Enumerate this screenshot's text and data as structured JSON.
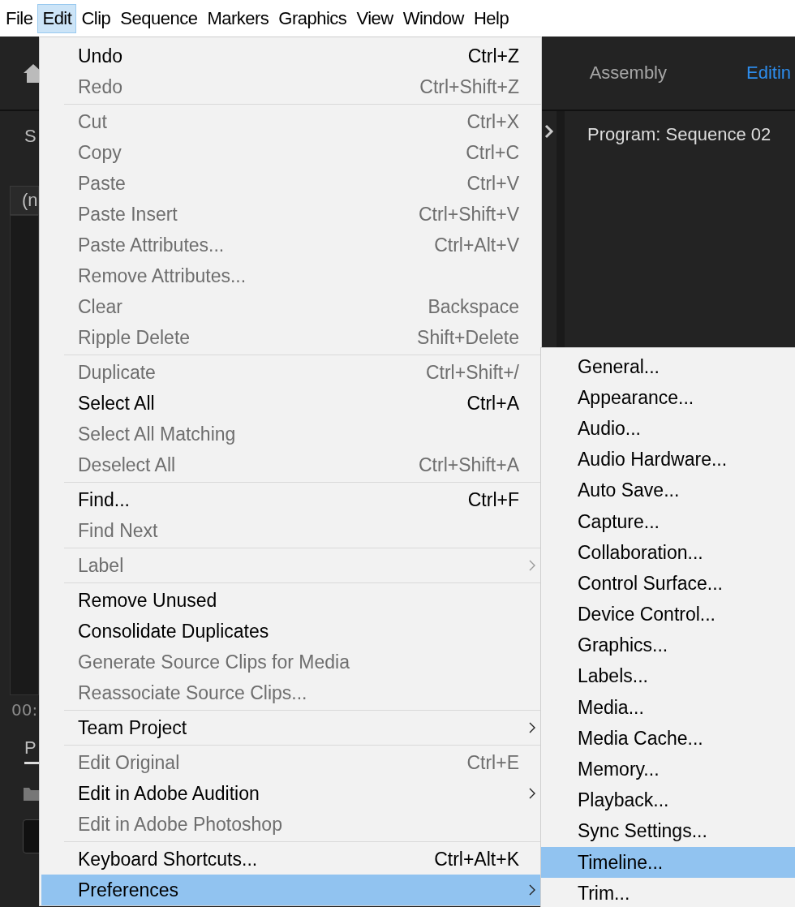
{
  "menubar": [
    {
      "label": "File",
      "selected": false
    },
    {
      "label": "Edit",
      "selected": true
    },
    {
      "label": "Clip",
      "selected": false
    },
    {
      "label": "Sequence",
      "selected": false
    },
    {
      "label": "Markers",
      "selected": false
    },
    {
      "label": "Graphics",
      "selected": false
    },
    {
      "label": "View",
      "selected": false
    },
    {
      "label": "Window",
      "selected": false
    },
    {
      "label": "Help",
      "selected": false
    }
  ],
  "workspace": {
    "tabs": [
      {
        "label": "Assembly",
        "selected": false
      },
      {
        "label": "Editin",
        "selected": true
      }
    ],
    "left_panel": {
      "tab": "S",
      "column": "(n",
      "timecode": "00:",
      "project_tab": "P"
    },
    "program_monitor": {
      "title": "Program: Sequence 02"
    }
  },
  "edit_menu": {
    "groups": [
      [
        {
          "label": "Undo",
          "shortcut": "Ctrl+Z",
          "disabled": false,
          "submenu": false,
          "selected": false
        },
        {
          "label": "Redo",
          "shortcut": "Ctrl+Shift+Z",
          "disabled": true,
          "submenu": false,
          "selected": false
        }
      ],
      [
        {
          "label": "Cut",
          "shortcut": "Ctrl+X",
          "disabled": true,
          "submenu": false,
          "selected": false
        },
        {
          "label": "Copy",
          "shortcut": "Ctrl+C",
          "disabled": true,
          "submenu": false,
          "selected": false
        },
        {
          "label": "Paste",
          "shortcut": "Ctrl+V",
          "disabled": true,
          "submenu": false,
          "selected": false
        },
        {
          "label": "Paste Insert",
          "shortcut": "Ctrl+Shift+V",
          "disabled": true,
          "submenu": false,
          "selected": false
        },
        {
          "label": "Paste Attributes...",
          "shortcut": "Ctrl+Alt+V",
          "disabled": true,
          "submenu": false,
          "selected": false
        },
        {
          "label": "Remove Attributes...",
          "disabled": true,
          "submenu": false,
          "selected": false
        },
        {
          "label": "Clear",
          "shortcut": "Backspace",
          "disabled": true,
          "submenu": false,
          "selected": false
        },
        {
          "label": "Ripple Delete",
          "shortcut": "Shift+Delete",
          "disabled": true,
          "submenu": false,
          "selected": false
        }
      ],
      [
        {
          "label": "Duplicate",
          "shortcut": "Ctrl+Shift+/",
          "disabled": true,
          "submenu": false,
          "selected": false
        },
        {
          "label": "Select All",
          "shortcut": "Ctrl+A",
          "disabled": false,
          "submenu": false,
          "selected": false
        },
        {
          "label": "Select All Matching",
          "disabled": true,
          "submenu": false,
          "selected": false
        },
        {
          "label": "Deselect All",
          "shortcut": "Ctrl+Shift+A",
          "disabled": true,
          "submenu": false,
          "selected": false
        }
      ],
      [
        {
          "label": "Find...",
          "shortcut": "Ctrl+F",
          "disabled": false,
          "submenu": false,
          "selected": false
        },
        {
          "label": "Find Next",
          "disabled": true,
          "submenu": false,
          "selected": false
        }
      ],
      [
        {
          "label": "Label",
          "disabled": true,
          "submenu": true,
          "selected": false
        }
      ],
      [
        {
          "label": "Remove Unused",
          "disabled": false,
          "submenu": false,
          "selected": false
        },
        {
          "label": "Consolidate Duplicates",
          "disabled": false,
          "submenu": false,
          "selected": false
        },
        {
          "label": "Generate Source Clips for Media",
          "disabled": true,
          "submenu": false,
          "selected": false
        },
        {
          "label": "Reassociate Source Clips...",
          "disabled": true,
          "submenu": false,
          "selected": false
        }
      ],
      [
        {
          "label": "Team Project",
          "disabled": false,
          "submenu": true,
          "selected": false
        }
      ],
      [
        {
          "label": "Edit Original",
          "shortcut": "Ctrl+E",
          "disabled": true,
          "submenu": false,
          "selected": false
        },
        {
          "label": "Edit in Adobe Audition",
          "disabled": false,
          "submenu": true,
          "selected": false
        },
        {
          "label": "Edit in Adobe Photoshop",
          "disabled": true,
          "submenu": false,
          "selected": false
        }
      ],
      [
        {
          "label": "Keyboard Shortcuts...",
          "shortcut": "Ctrl+Alt+K",
          "disabled": false,
          "submenu": false,
          "selected": false
        },
        {
          "label": "Preferences",
          "disabled": false,
          "submenu": true,
          "selected": true
        }
      ]
    ]
  },
  "preferences_submenu": {
    "items": [
      {
        "label": "General...",
        "selected": false
      },
      {
        "label": "Appearance...",
        "selected": false
      },
      {
        "label": "Audio...",
        "selected": false
      },
      {
        "label": "Audio Hardware...",
        "selected": false
      },
      {
        "label": "Auto Save...",
        "selected": false
      },
      {
        "label": "Capture...",
        "selected": false
      },
      {
        "label": "Collaboration...",
        "selected": false
      },
      {
        "label": "Control Surface...",
        "selected": false
      },
      {
        "label": "Device Control...",
        "selected": false
      },
      {
        "label": "Graphics...",
        "selected": false
      },
      {
        "label": "Labels...",
        "selected": false
      },
      {
        "label": "Media...",
        "selected": false
      },
      {
        "label": "Media Cache...",
        "selected": false
      },
      {
        "label": "Memory...",
        "selected": false
      },
      {
        "label": "Playback...",
        "selected": false
      },
      {
        "label": "Sync Settings...",
        "selected": false
      },
      {
        "label": "Timeline...",
        "selected": true
      },
      {
        "label": "Trim...",
        "selected": false
      }
    ]
  }
}
